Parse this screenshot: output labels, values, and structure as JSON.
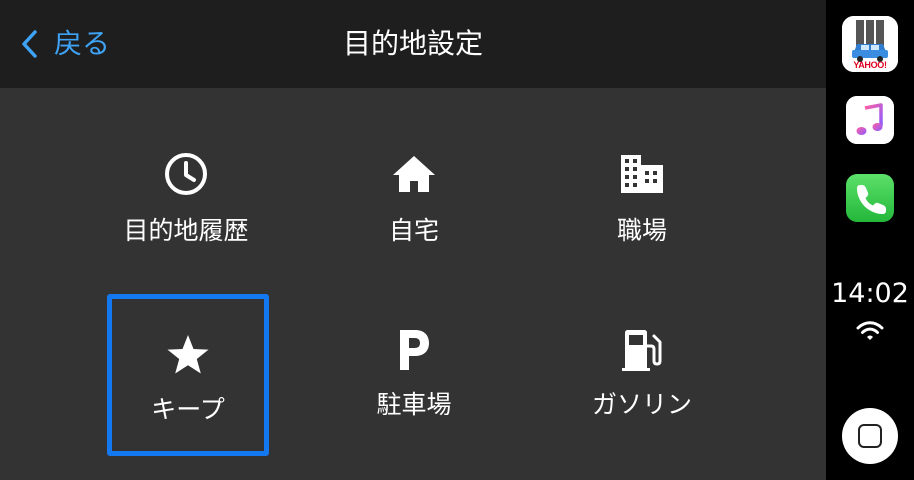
{
  "header": {
    "back_label": "戻る",
    "title": "目的地設定"
  },
  "grid": {
    "items": [
      {
        "label": "目的地履歴",
        "icon": "clock-icon"
      },
      {
        "label": "自宅",
        "icon": "home-icon"
      },
      {
        "label": "職場",
        "icon": "office-building-icon"
      },
      {
        "label": "キープ",
        "icon": "star-icon",
        "focused": true
      },
      {
        "label": "駐車場",
        "icon": "parking-icon"
      },
      {
        "label": "ガソリン",
        "icon": "gas-station-icon"
      }
    ]
  },
  "dock": {
    "apps": [
      {
        "name": "Yahoo! Car Navi",
        "icon": "yahoo-carnavi-icon",
        "logo_text": "YAHOO!"
      },
      {
        "name": "Music",
        "icon": "music-icon"
      },
      {
        "name": "Phone",
        "icon": "phone-icon"
      }
    ],
    "time": "14:02",
    "status_icon": "wifi-icon"
  },
  "colors": {
    "accent": "#3ea2f5",
    "focus_ring": "#1478f0",
    "header_bg": "#1e1e1e",
    "content_bg": "#333333",
    "dock_bg": "#000000"
  }
}
